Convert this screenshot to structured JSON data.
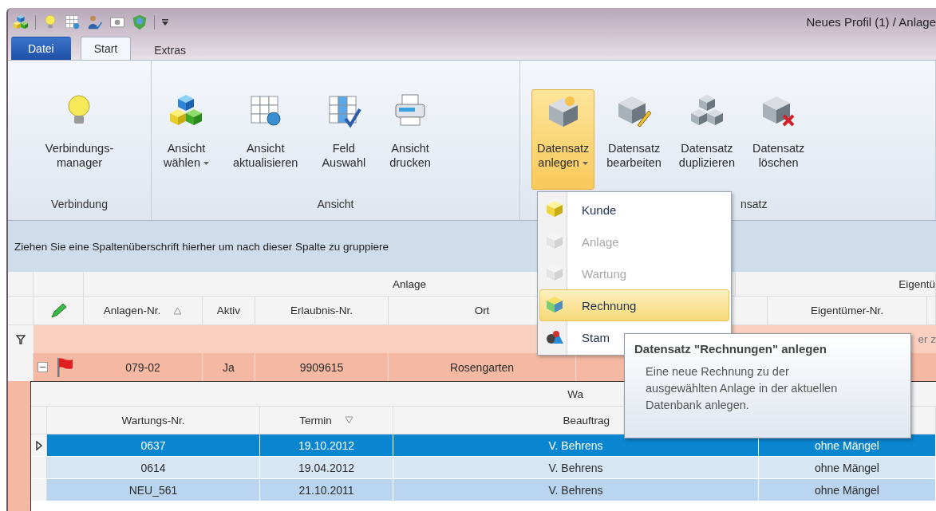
{
  "window": {
    "title": "Neues Profil (1) / Anlage"
  },
  "tabs": [
    {
      "label": "Datei",
      "kind": "file",
      "selected": false
    },
    {
      "label": "Start",
      "kind": "tab",
      "selected": true
    },
    {
      "label": "Extras",
      "kind": "tab",
      "selected": false
    }
  ],
  "ribbon": {
    "groups": [
      {
        "label": "Verbindung",
        "buttons": [
          {
            "lines": [
              "Verbindungs-",
              "manager"
            ],
            "kind": "bulb",
            "dropdown": false,
            "open": false
          }
        ]
      },
      {
        "label": "Ansicht",
        "buttons": [
          {
            "lines": [
              "Ansicht",
              "wählen"
            ],
            "kind": "cubes",
            "dropdown": true,
            "open": false
          },
          {
            "lines": [
              "Ansicht",
              "aktualisieren"
            ],
            "kind": "grid-refresh",
            "dropdown": false,
            "open": false
          },
          {
            "lines": [
              "Feld",
              "Auswahl"
            ],
            "kind": "grid-check",
            "dropdown": false,
            "open": false
          },
          {
            "lines": [
              "Ansicht",
              "drucken"
            ],
            "kind": "printer",
            "dropdown": false,
            "open": false
          }
        ]
      },
      {
        "label": "nsatz",
        "buttons": [
          {
            "lines": [
              "Datensatz",
              "anlegen"
            ],
            "kind": "cube-new",
            "dropdown": true,
            "open": true
          },
          {
            "lines": [
              "Datensatz",
              "bearbeiten"
            ],
            "kind": "cube-edit",
            "dropdown": false,
            "open": false
          },
          {
            "lines": [
              "Datensatz",
              "duplizieren"
            ],
            "kind": "cubes-gray",
            "dropdown": false,
            "open": false
          },
          {
            "lines": [
              "Datensatz",
              "löschen"
            ],
            "kind": "cube-delete",
            "dropdown": false,
            "open": false
          }
        ]
      }
    ]
  },
  "group_panel": {
    "text": "Ziehen Sie eine Spaltenüberschrift hierher um nach dieser Spalte zu gruppiere"
  },
  "grid": {
    "bands": [
      {
        "label": "Anlage"
      },
      {
        "label": "Eigentü"
      }
    ],
    "columns": [
      {
        "kind": "text",
        "label": "Anlagen-Nr.",
        "sorted_ascending": true
      },
      {
        "kind": "text",
        "label": "Aktiv"
      },
      {
        "kind": "text",
        "label": "Erlaubnis-Nr."
      },
      {
        "kind": "text",
        "label": "Ort"
      },
      {
        "kind": "blank"
      },
      {
        "kind": "text",
        "label": "Eigentümer-Nr."
      },
      {
        "kind": "blank"
      }
    ],
    "filter_row": {
      "hint": "er z"
    },
    "rows": [
      {
        "expanded": true,
        "flagged": true,
        "cells": [
          "079-02",
          "Ja",
          "9909615",
          "Rosengarten"
        ]
      }
    ],
    "detail": {
      "band": "Wa",
      "columns": [
        {
          "label": "Wartungs-Nr."
        },
        {
          "label": "Termin",
          "sorted_descending": true
        },
        {
          "label": "Beauftrag"
        },
        {}
      ],
      "rows": [
        {
          "selected": true,
          "cells": [
            "0637",
            "19.10.2012",
            "V. Behrens",
            "ohne Mängel"
          ]
        },
        {
          "selected": false,
          "cells": [
            "0614",
            "19.04.2012",
            "V. Behrens",
            "ohne Mängel"
          ]
        },
        {
          "selected": false,
          "cells": [
            "NEU_561",
            "21.10.2011",
            "V. Behrens",
            "ohne Mängel"
          ]
        }
      ]
    }
  },
  "menu": {
    "items": [
      {
        "label": "Kunde",
        "kind": "yellow-cube",
        "disabled": false,
        "selected": false
      },
      {
        "label": "Anlage",
        "kind": "gray-cube",
        "disabled": true,
        "selected": false
      },
      {
        "label": "Wartung",
        "kind": "gray-cube",
        "disabled": true,
        "selected": false
      },
      {
        "label": "Rechnung",
        "kind": "color-cube",
        "disabled": false,
        "selected": true
      },
      {
        "label": "Stam",
        "kind": "shapes",
        "disabled": false,
        "selected": false
      }
    ]
  },
  "tooltip": {
    "title": "Datensatz \"Rechnungen\" anlegen",
    "body": "Eine neue Rechnung zu der ausgewählten Anlage in der aktuellen Datenbank anlegen."
  }
}
